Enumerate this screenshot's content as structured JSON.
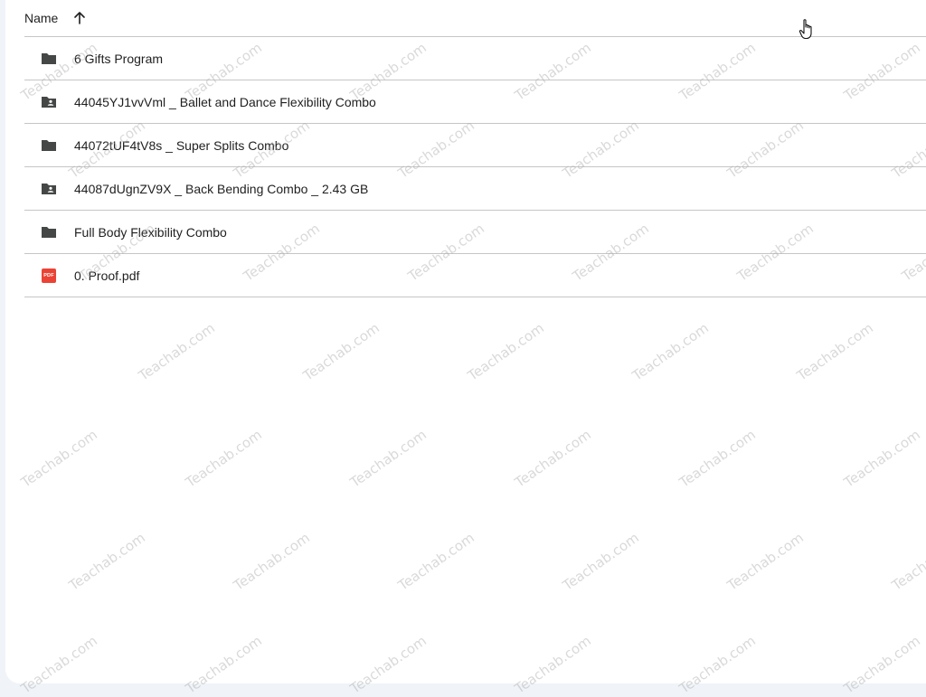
{
  "header": {
    "name_label": "Name",
    "sort_icon": "arrow-upward-icon"
  },
  "files": [
    {
      "name": "6 Gifts Program",
      "icon": "folder-icon"
    },
    {
      "name": "44045YJ1vvVml _ Ballet and Dance Flexibility Combo",
      "icon": "shared-folder-icon"
    },
    {
      "name": "44072tUF4tV8s _ Super Splits Combo",
      "icon": "folder-icon"
    },
    {
      "name": "44087dUgnZV9X _ Back Bending Combo _ 2.43 GB",
      "icon": "shared-folder-icon"
    },
    {
      "name": "Full Body Flexibility Combo",
      "icon": "folder-icon"
    },
    {
      "name": "0. Proof.pdf",
      "icon": "pdf-icon"
    }
  ],
  "pdf_badge_text": "PDF",
  "watermark": "Teachab.com",
  "colors": {
    "folder": "#444746",
    "pdf": "#ea4335",
    "divider": "#c4c7c5",
    "background": "#f0f4f9"
  }
}
